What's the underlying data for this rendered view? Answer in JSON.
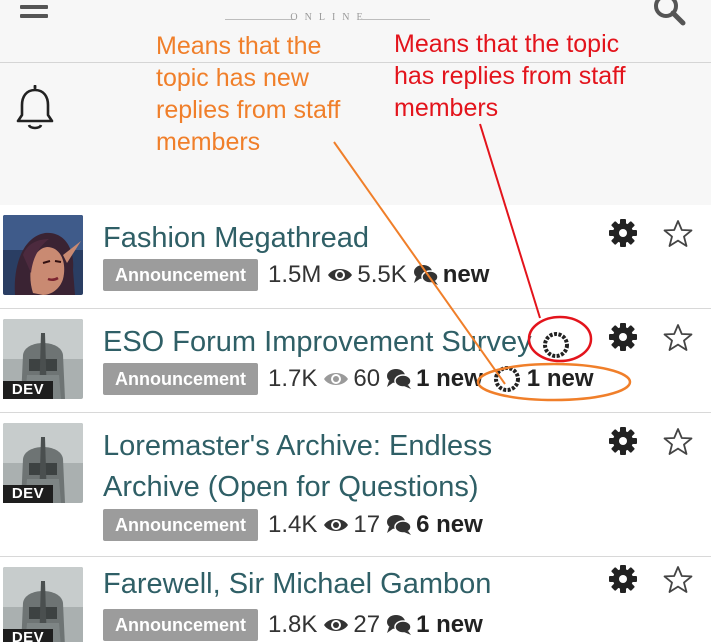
{
  "header": {
    "logo_text": "ONLINE",
    "menu_icon": "hamburger-menu-icon",
    "search_icon": "search-icon"
  },
  "notifications": {
    "icon": "bell-icon"
  },
  "annotations": {
    "orange": [
      "Means that the",
      "topic has new",
      "replies from staff",
      "members"
    ],
    "red": [
      "Means that the topic",
      "has replies from staff",
      "members"
    ],
    "colors": {
      "orange": "#f07f2a",
      "red": "#e3141c"
    }
  },
  "topics": [
    {
      "title": [
        "Fashion Megathread"
      ],
      "tag": "Announcement",
      "views": "1.5M",
      "comments": "5.5K",
      "new": "new",
      "avatar": "elf-avatar",
      "dev": false,
      "staff_marker": false
    },
    {
      "title": [
        "ESO Forum Improvement Survey"
      ],
      "tag": "Announcement",
      "views": "1.7K",
      "comments": "60",
      "new": "1 new",
      "staff_new": "1 new",
      "avatar": "dev-avatar",
      "dev": true,
      "dev_label": "DEV",
      "staff_marker": true
    },
    {
      "title": [
        "Loremaster's Archive: Endless",
        "Archive (Open for Questions)"
      ],
      "tag": "Announcement",
      "views": "1.4K",
      "comments": "17",
      "new": "6 new",
      "avatar": "dev-avatar",
      "dev": true,
      "dev_label": "DEV",
      "staff_marker": false
    },
    {
      "title": [
        "Farewell, Sir Michael Gambon"
      ],
      "tag": "Announcement",
      "views": "1.8K",
      "comments": "27",
      "new": "1 new",
      "avatar": "dev-avatar",
      "dev": true,
      "dev_label": "DEV",
      "staff_marker": false
    }
  ],
  "colors": {
    "title": "#2f5f66",
    "tag_bg": "#9c9c9c",
    "background": "#f7f7f7"
  }
}
